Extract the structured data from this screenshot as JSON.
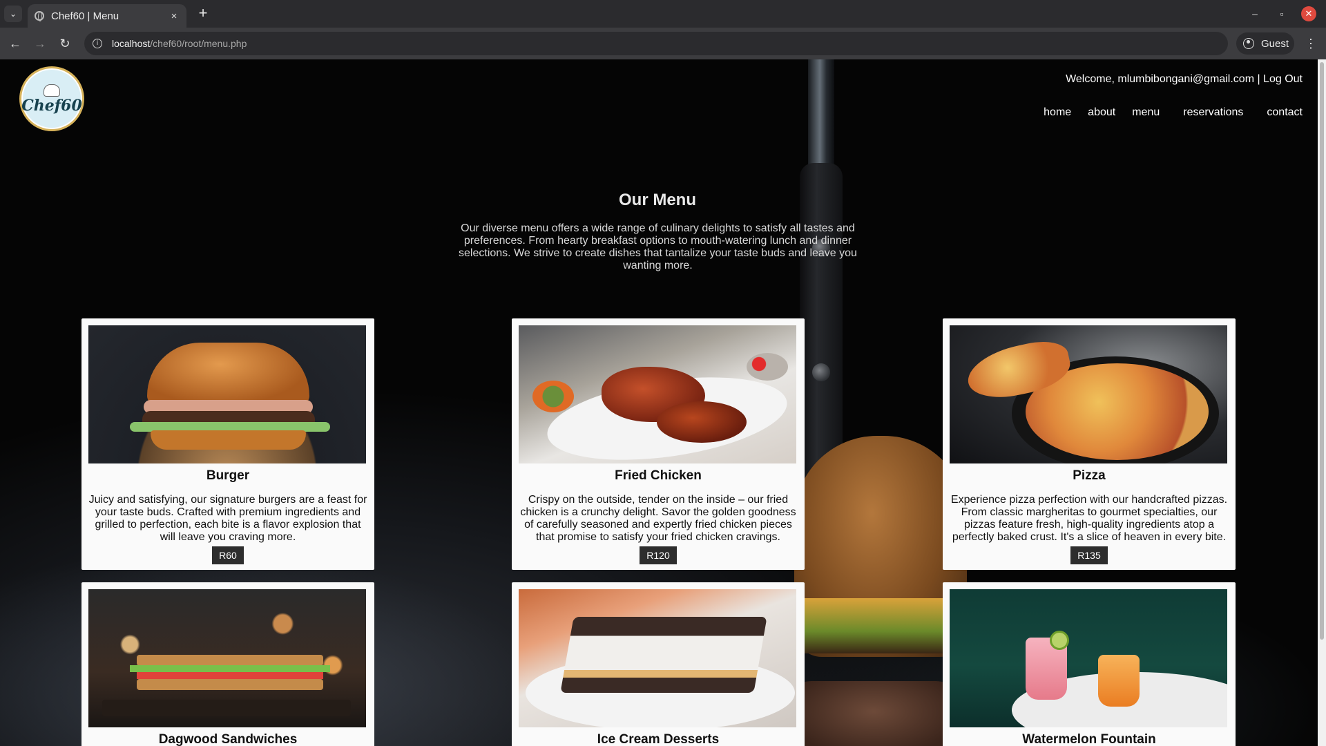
{
  "browser": {
    "tab_title": "Chef60 | Menu",
    "tab_close": "×",
    "new_tab": "+",
    "tab_list": "⌄",
    "url_host": "localhost",
    "url_path": "/chef60/root/menu.php",
    "profile_label": "Guest",
    "win_minimize": "–",
    "win_restore": "▫",
    "win_close": "✕",
    "nav_back": "←",
    "nav_forward": "→",
    "nav_reload": "↻",
    "menu_kebab": "⋮",
    "info_glyph": "i"
  },
  "site": {
    "logo_text": "Chef60",
    "welcome": "Welcome, mlumbibongani@gmail.com | Log Out",
    "nav": [
      "home",
      "about",
      "menu",
      "reservations",
      "contact"
    ]
  },
  "hero": {
    "title": "Our Menu",
    "text": "Our diverse menu offers a wide range of culinary delights to satisfy all tastes and preferences. From hearty breakfast options to mouth-watering lunch and dinner selections. We strive to create dishes that tantalize your taste buds and leave you wanting more."
  },
  "menu": [
    {
      "name": "Burger",
      "desc": "Juicy and satisfying, our signature burgers are a feast for your taste buds. Crafted with premium ingredients and grilled to perfection, each bite is a flavor explosion that will leave you craving more.",
      "price": "R60"
    },
    {
      "name": "Fried Chicken",
      "desc": "Crispy on the outside, tender on the inside – our fried chicken is a crunchy delight. Savor the golden goodness of carefully seasoned and expertly fried chicken pieces that promise to satisfy your fried chicken cravings.",
      "price": "R120"
    },
    {
      "name": "Pizza",
      "desc": "Experience pizza perfection with our handcrafted pizzas. From classic margheritas to gourmet specialties, our pizzas feature fresh, high-quality ingredients atop a perfectly baked crust. It's a slice of heaven in every bite.",
      "price": "R135"
    },
    {
      "name": "Dagwood Sandwiches"
    },
    {
      "name": "Ice Cream Desserts"
    },
    {
      "name": "Watermelon Fountain"
    }
  ]
}
